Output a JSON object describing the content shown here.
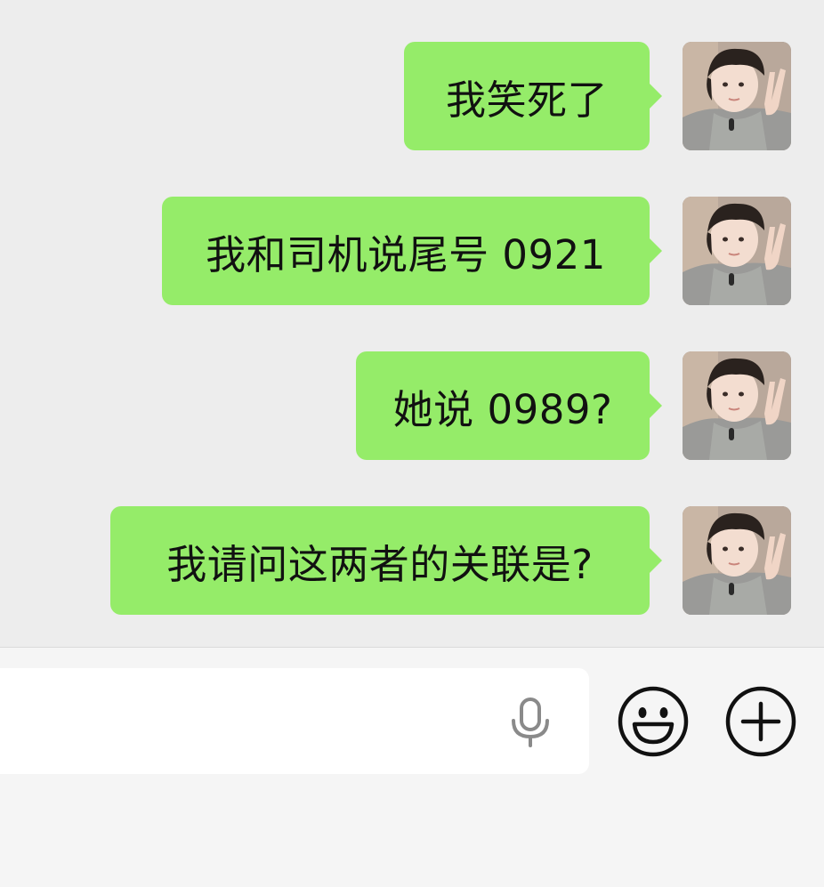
{
  "messages": [
    {
      "text": "我笑死了",
      "sender": "self"
    },
    {
      "text": "我和司机说尾号 0921",
      "sender": "self"
    },
    {
      "text": "她说 0989?",
      "sender": "self"
    },
    {
      "text": "我请问这两者的关联是?",
      "sender": "self"
    }
  ],
  "input_bar": {
    "text_value": "",
    "voice_icon": "microphone-icon",
    "emoji_icon": "smiley-face-icon",
    "more_icon": "plus-circle-icon"
  },
  "colors": {
    "chat_background": "#ededed",
    "bubble_self": "#95ec69",
    "input_bar_background": "#f5f5f5",
    "text": "#111111",
    "icon": "#111111",
    "mic_icon": "#8a8a8a"
  }
}
